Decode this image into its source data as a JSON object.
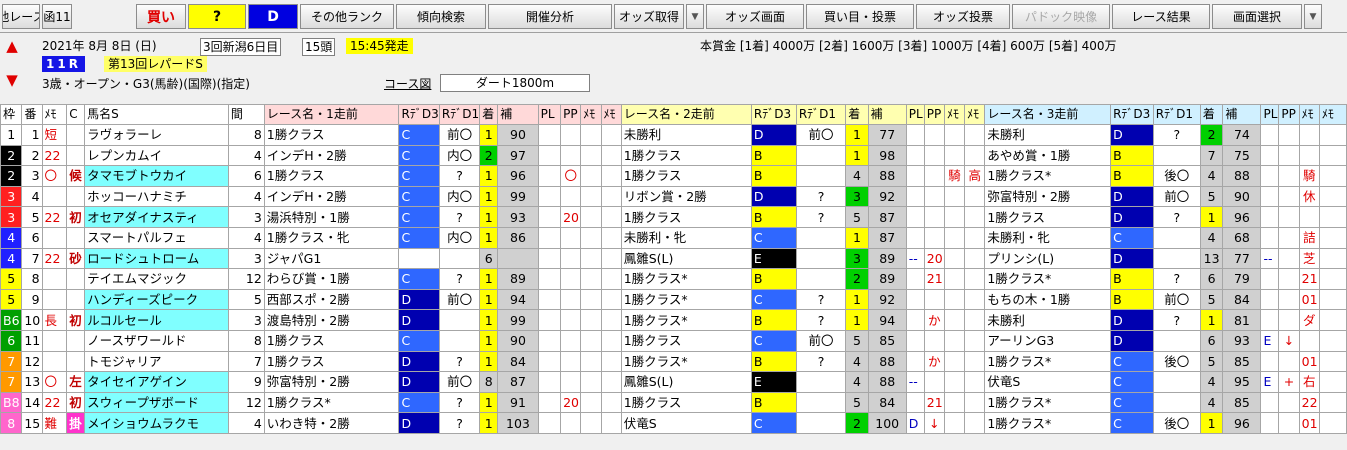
{
  "toolbar": {
    "b1": "他レース",
    "b2": "函11",
    "b3": "買い",
    "b4": "?",
    "b5": "D",
    "b6": "その他ランク",
    "b7": "傾向検索",
    "b8": "開催分析",
    "b9": "オッズ取得",
    "b10": "オッズ画面",
    "b11": "買い目・投票",
    "b12": "オッズ投票",
    "b13": "パドック映像",
    "b14": "レース結果",
    "b15": "画面選択",
    "arrow": "▼"
  },
  "race": {
    "date": "2021年 8月 8日 (日)",
    "meet": "3回新潟6日目",
    "heads": "15頭",
    "start": "15:45発走",
    "prize": "本賞金 [1着] 4000万 [2着] 1600万 [3着] 1000万 [4着] 600万 [5着] 400万",
    "num": "11R",
    "name": "第13回レパードS",
    "cond": "3歳・オープン・G3(馬齢)(国際)(指定)",
    "course_label": "コース図",
    "course": "ダート1800m"
  },
  "head": {
    "waku": "枠",
    "ban": "番",
    "mark": "ﾒﾓ",
    "c": "C",
    "name": "馬名S",
    "kan": "間",
    "r1": "レース名・1走前",
    "rd3": "RﾃﾞD3",
    "rd1": "RﾃﾞD1",
    "ch": "着",
    "ho": "補",
    "pl": "PL",
    "pp": "PP",
    "m1": "ﾒﾓ",
    "m2": "ﾒﾓ",
    "r2": "レース名・2走前",
    "r3": "レース名・3走前"
  },
  "rows": [
    {
      "waku": "1",
      "ban": "1",
      "num": "",
      "mark": "短",
      "tag": "",
      "name": "ラヴォラーレ",
      "kan": "8",
      "a": [
        "1勝クラス",
        "C",
        "前〇",
        "1",
        "90",
        "",
        "",
        "",
        ""
      ],
      "b": [
        "未勝利",
        "D",
        "前〇",
        "1",
        "77",
        "",
        "",
        "",
        ""
      ],
      "c": [
        "未勝利",
        "D",
        "?",
        "2",
        "74",
        "",
        "",
        "",
        ""
      ]
    },
    {
      "waku": "2",
      "ban": "2",
      "num": "22",
      "mark": "",
      "tag": "",
      "name": "レプンカムイ",
      "kan": "4",
      "a": [
        "インデH・2勝",
        "C",
        "内〇",
        "2",
        "97",
        "",
        "",
        "",
        ""
      ],
      "b": [
        "1勝クラス",
        "B",
        "",
        "1",
        "98",
        "",
        "",
        "",
        ""
      ],
      "c": [
        "あやめ賞・1勝",
        "B",
        "",
        "7",
        "75",
        "",
        "",
        "",
        ""
      ]
    },
    {
      "waku": "2",
      "ban": "3",
      "num": "",
      "mark": "〇",
      "tag": "候",
      "name": "タマモブトウカイ",
      "kan": "6",
      "a": [
        "1勝クラス",
        "C",
        "?",
        "1",
        "96",
        "",
        "〇",
        "",
        ""
      ],
      "b": [
        "1勝クラス",
        "B",
        "",
        "4",
        "88",
        "",
        "",
        "騎",
        "高"
      ],
      "c": [
        "1勝クラス*",
        "B",
        "後〇",
        "4",
        "88",
        "",
        "",
        "騎",
        ""
      ]
    },
    {
      "waku": "3",
      "ban": "4",
      "num": "",
      "mark": "",
      "tag": "",
      "name": "ホッコーハナミチ",
      "kan": "4",
      "a": [
        "インデH・2勝",
        "C",
        "内〇",
        "1",
        "99",
        "",
        "",
        "",
        ""
      ],
      "b": [
        "リボン賞・2勝",
        "D",
        "?",
        "3",
        "92",
        "",
        "",
        "",
        ""
      ],
      "c": [
        "弥富特別・2勝",
        "D",
        "前〇",
        "5",
        "90",
        "",
        "",
        "休",
        ""
      ]
    },
    {
      "waku": "3",
      "ban": "5",
      "num": "22",
      "mark": "",
      "tag": "初",
      "name": "オセアダイナスティ",
      "kan": "3",
      "a": [
        "湯浜特別・1勝",
        "C",
        "?",
        "1",
        "93",
        "",
        "20",
        "",
        ""
      ],
      "b": [
        "1勝クラス",
        "B",
        "?",
        "5",
        "87",
        "",
        "",
        "",
        ""
      ],
      "c": [
        "1勝クラス",
        "D",
        "?",
        "1",
        "96",
        "",
        "",
        "",
        ""
      ]
    },
    {
      "waku": "4",
      "ban": "6",
      "num": "",
      "mark": "",
      "tag": "",
      "name": "スマートパルフェ",
      "kan": "4",
      "a": [
        "1勝クラス・牝",
        "C",
        "内〇",
        "1",
        "86",
        "",
        "",
        "",
        ""
      ],
      "b": [
        "未勝利・牝",
        "C",
        "",
        "1",
        "87",
        "",
        "",
        "",
        ""
      ],
      "c": [
        "未勝利・牝",
        "C",
        "",
        "4",
        "68",
        "",
        "",
        "詰",
        ""
      ]
    },
    {
      "waku": "4",
      "ban": "7",
      "num": "22",
      "mark": "",
      "tag": "砂",
      "name": "ロードシュトローム",
      "kan": "3",
      "a": [
        "ジャパG1",
        "",
        "",
        "6",
        "",
        "",
        "",
        "",
        ""
      ],
      "b": [
        "鳳雛S(L)",
        "E",
        "",
        "3",
        "89",
        "--",
        "20",
        "",
        ""
      ],
      "c": [
        "プリンシ(L)",
        "D",
        "",
        "13",
        "77",
        "--",
        "",
        "芝",
        ""
      ]
    },
    {
      "waku": "5",
      "ban": "8",
      "num": "",
      "mark": "",
      "tag": "",
      "name": "テイエムマジック",
      "kan": "12",
      "a": [
        "わらび賞・1勝",
        "C",
        "?",
        "1",
        "89",
        "",
        "",
        "",
        ""
      ],
      "b": [
        "1勝クラス*",
        "B",
        "",
        "2",
        "89",
        "",
        "21",
        "",
        ""
      ],
      "c": [
        "1勝クラス*",
        "B",
        "?",
        "6",
        "79",
        "",
        "",
        "21",
        ""
      ]
    },
    {
      "waku": "5",
      "ban": "9",
      "num": "",
      "mark": "",
      "tag": "",
      "name": "ハンディーズピーク",
      "kan": "5",
      "a": [
        "西部スポ・2勝",
        "D",
        "前〇",
        "1",
        "94",
        "",
        "",
        "",
        ""
      ],
      "b": [
        "1勝クラス*",
        "C",
        "?",
        "1",
        "92",
        "",
        "",
        "",
        ""
      ],
      "c": [
        "もちの木・1勝",
        "B",
        "前〇",
        "5",
        "84",
        "",
        "",
        "01",
        ""
      ]
    },
    {
      "waku": "B6",
      "ban": "10",
      "num": "",
      "mark": "長",
      "tag": "初",
      "name": "ルコルセール",
      "kan": "3",
      "a": [
        "渡島特別・2勝",
        "D",
        "",
        "1",
        "99",
        "",
        "",
        "",
        ""
      ],
      "b": [
        "1勝クラス*",
        "B",
        "?",
        "1",
        "94",
        "",
        "か",
        "",
        ""
      ],
      "c": [
        "未勝利",
        "D",
        "?",
        "1",
        "81",
        "",
        "",
        "ダ",
        ""
      ]
    },
    {
      "waku": "6",
      "ban": "11",
      "num": "",
      "mark": "",
      "tag": "",
      "name": "ノースザワールド",
      "kan": "8",
      "a": [
        "1勝クラス",
        "C",
        "",
        "1",
        "90",
        "",
        "",
        "",
        ""
      ],
      "b": [
        "1勝クラス",
        "C",
        "前〇",
        "5",
        "85",
        "",
        "",
        "",
        ""
      ],
      "c": [
        "アーリンG3",
        "D",
        "",
        "6",
        "93",
        "E",
        "↓",
        "",
        ""
      ]
    },
    {
      "waku": "7",
      "ban": "12",
      "num": "",
      "mark": "",
      "tag": "",
      "name": "トモジャリア",
      "kan": "7",
      "a": [
        "1勝クラス",
        "D",
        "?",
        "1",
        "84",
        "",
        "",
        "",
        ""
      ],
      "b": [
        "1勝クラス*",
        "B",
        "?",
        "4",
        "88",
        "",
        "か",
        "",
        ""
      ],
      "c": [
        "1勝クラス*",
        "C",
        "後〇",
        "5",
        "85",
        "",
        "",
        "01",
        ""
      ]
    },
    {
      "waku": "7",
      "ban": "13",
      "num": "",
      "mark": "〇",
      "tag": "左",
      "name": "タイセイアゲイン",
      "kan": "9",
      "a": [
        "弥富特別・2勝",
        "D",
        "前〇",
        "8",
        "87",
        "",
        "",
        "",
        ""
      ],
      "b": [
        "鳳雛S(L)",
        "E",
        "",
        "4",
        "88",
        "--",
        "",
        "",
        ""
      ],
      "c": [
        "伏竜S",
        "C",
        "",
        "4",
        "95",
        "E",
        "+",
        "右",
        ""
      ]
    },
    {
      "waku": "B8",
      "ban": "14",
      "num": "22",
      "mark": "",
      "tag": "初",
      "name": "スウィープザボード",
      "kan": "12",
      "a": [
        "1勝クラス*",
        "C",
        "?",
        "1",
        "91",
        "",
        "20",
        "",
        ""
      ],
      "b": [
        "1勝クラス",
        "B",
        "",
        "5",
        "84",
        "",
        "21",
        "",
        ""
      ],
      "c": [
        "1勝クラス*",
        "C",
        "",
        "4",
        "85",
        "",
        "",
        "22",
        ""
      ]
    },
    {
      "waku": "8",
      "ban": "15",
      "num": "",
      "mark": "難",
      "tag": "掛",
      "name": "メイショウムラクモ",
      "kan": "4",
      "a": [
        "いわき特・2勝",
        "D",
        "?",
        "1",
        "103",
        "",
        "",
        "",
        ""
      ],
      "b": [
        "伏竜S",
        "C",
        "",
        "2",
        "100",
        "D",
        "↓",
        "",
        ""
      ],
      "c": [
        "1勝クラス*",
        "C",
        "後〇",
        "1",
        "96",
        "",
        "",
        "01",
        ""
      ]
    }
  ]
}
